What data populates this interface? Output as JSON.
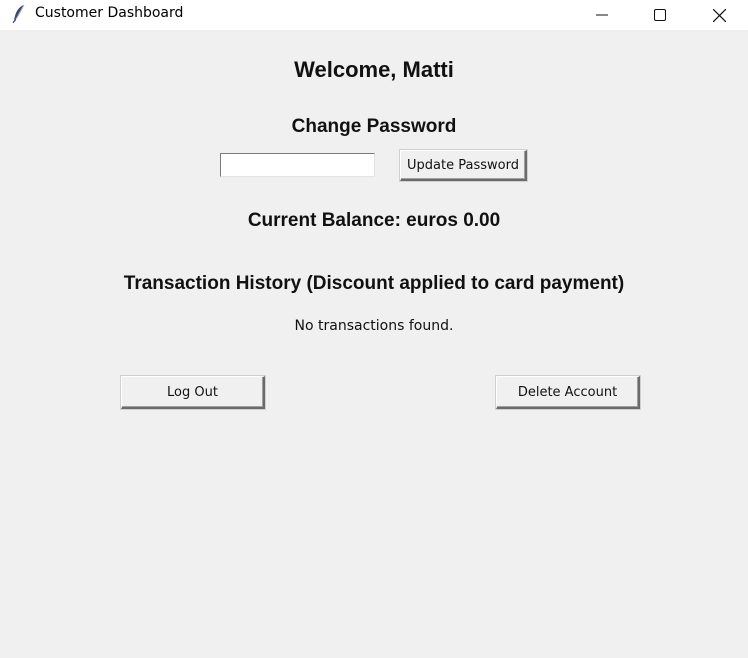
{
  "window": {
    "title": "Customer Dashboard",
    "icon": "feather-icon"
  },
  "dashboard": {
    "welcome": "Welcome, Matti",
    "change_password_heading": "Change Password",
    "password_value": "",
    "update_password_label": "Update Password",
    "balance_text": "Current Balance: euros 0.00",
    "history_heading": "Transaction History (Discount applied to card payment)",
    "no_transactions": "No transactions found.",
    "logout_label": "Log Out",
    "delete_label": "Delete Account"
  }
}
